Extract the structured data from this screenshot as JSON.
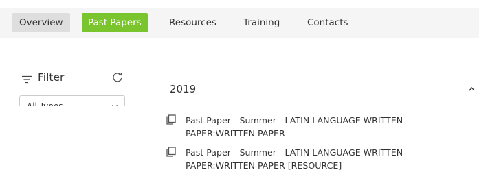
{
  "nav": {
    "tabs": [
      {
        "label": "Overview"
      },
      {
        "label": "Past Papers",
        "active": true
      },
      {
        "label": "Resources"
      },
      {
        "label": "Training"
      },
      {
        "label": "Contacts"
      }
    ]
  },
  "filter": {
    "title": "Filter",
    "type_select": {
      "value": "All Types"
    }
  },
  "results": {
    "year": "2019",
    "items": [
      {
        "title": "Past Paper - Summer - LATIN LANGUAGE WRITTEN PAPER:WRITTEN PAPER",
        "icon": "document-copy-icon"
      },
      {
        "title": "Past Paper - Summer - LATIN LANGUAGE WRITTEN PAPER:WRITTEN PAPER [RESOURCE]",
        "icon": "document-copy-icon"
      }
    ]
  },
  "colors": {
    "accent": "#7ac52e",
    "navbar_bg": "#f5f5f5",
    "tab_selected_bg": "#dedede",
    "text": "#333333"
  }
}
